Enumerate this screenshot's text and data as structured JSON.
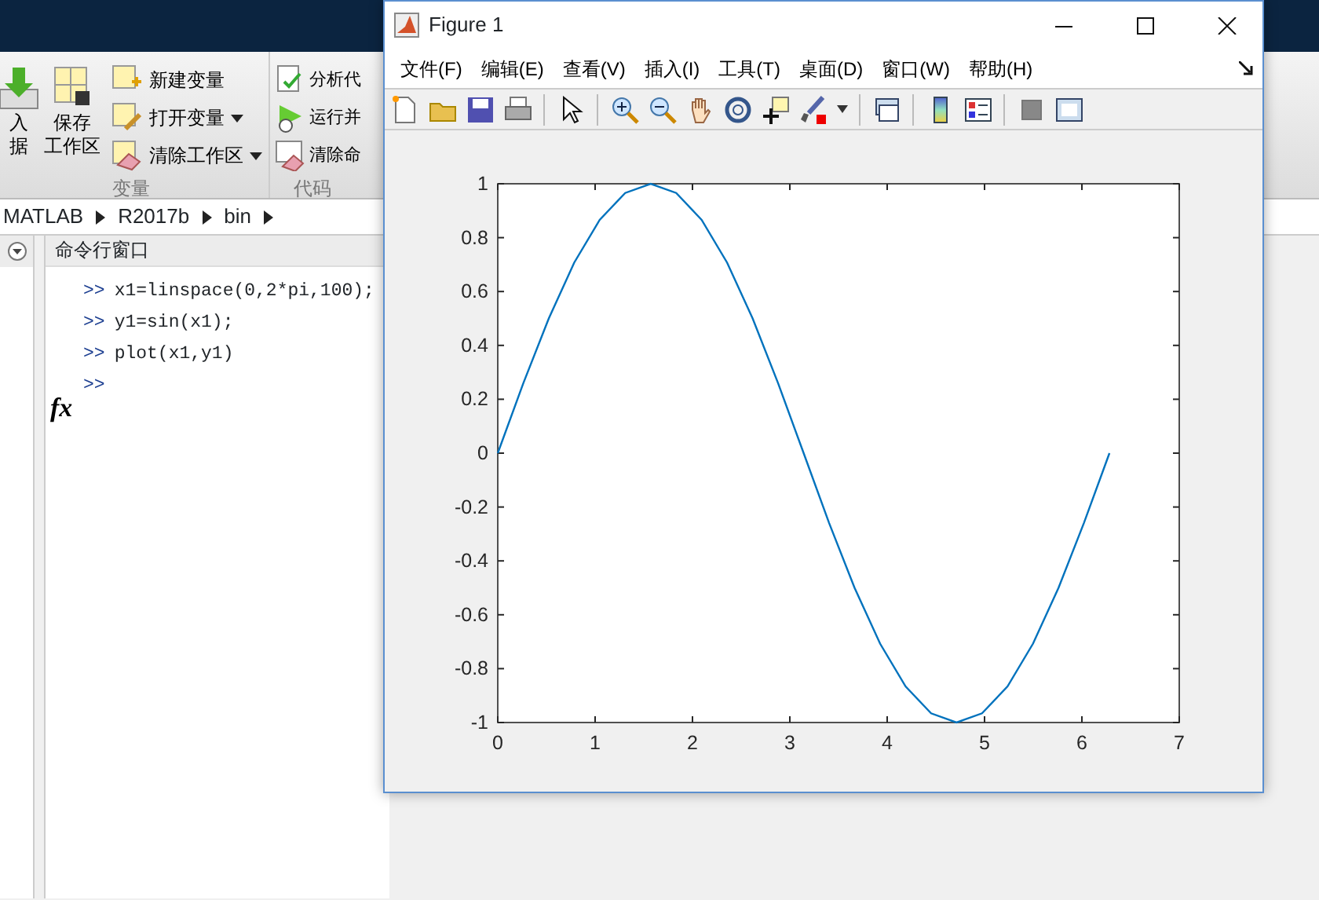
{
  "matlab": {
    "toolstrip": {
      "import_button": {
        "lines": [
          "入",
          "据"
        ]
      },
      "save_button": {
        "lines": [
          "保存",
          "工作区"
        ]
      },
      "variable_actions": [
        {
          "label": "新建变量",
          "dropdown": false
        },
        {
          "label": "打开变量",
          "dropdown": true
        },
        {
          "label": "清除工作区",
          "dropdown": true
        }
      ],
      "variable_section": "变量",
      "code_actions": [
        {
          "label": "分析代"
        },
        {
          "label": "运行并"
        },
        {
          "label": "清除命"
        }
      ],
      "code_section": "代码"
    },
    "breadcrumb": [
      "MATLAB",
      "R2017b",
      "bin"
    ],
    "command_window": {
      "title": "命令行窗口",
      "function_button": "fx",
      "lines": [
        "x1=linspace(0,2*pi,100);",
        "y1=sin(x1);",
        "plot(x1,y1)"
      ],
      "prompt": ">>"
    }
  },
  "figure": {
    "title": "Figure 1",
    "menu": [
      "文件(F)",
      "编辑(E)",
      "查看(V)",
      "插入(I)",
      "工具(T)",
      "桌面(D)",
      "窗口(W)",
      "帮助(H)"
    ],
    "chart_data": {
      "type": "line",
      "xlim": [
        0,
        7
      ],
      "ylim": [
        -1,
        1
      ],
      "xticks": [
        0,
        1,
        2,
        3,
        4,
        5,
        6,
        7
      ],
      "yticks": [
        -1,
        -0.8,
        -0.6,
        -0.4,
        -0.2,
        0,
        0.2,
        0.4,
        0.6,
        0.8,
        1
      ],
      "x": [
        0,
        0.262,
        0.524,
        0.785,
        1.047,
        1.309,
        1.571,
        1.833,
        2.094,
        2.356,
        2.618,
        2.88,
        3.142,
        3.403,
        3.665,
        3.927,
        4.189,
        4.451,
        4.712,
        4.974,
        5.236,
        5.498,
        5.76,
        6.021,
        6.283
      ],
      "series": [
        {
          "color": "#0072bd",
          "values": [
            0,
            0.259,
            0.5,
            0.707,
            0.866,
            0.966,
            1,
            0.966,
            0.866,
            0.707,
            0.5,
            0.259,
            0,
            -0.259,
            -0.5,
            -0.707,
            -0.866,
            -0.966,
            -1,
            -0.966,
            -0.866,
            -0.707,
            -0.5,
            -0.259,
            0
          ]
        }
      ]
    }
  }
}
